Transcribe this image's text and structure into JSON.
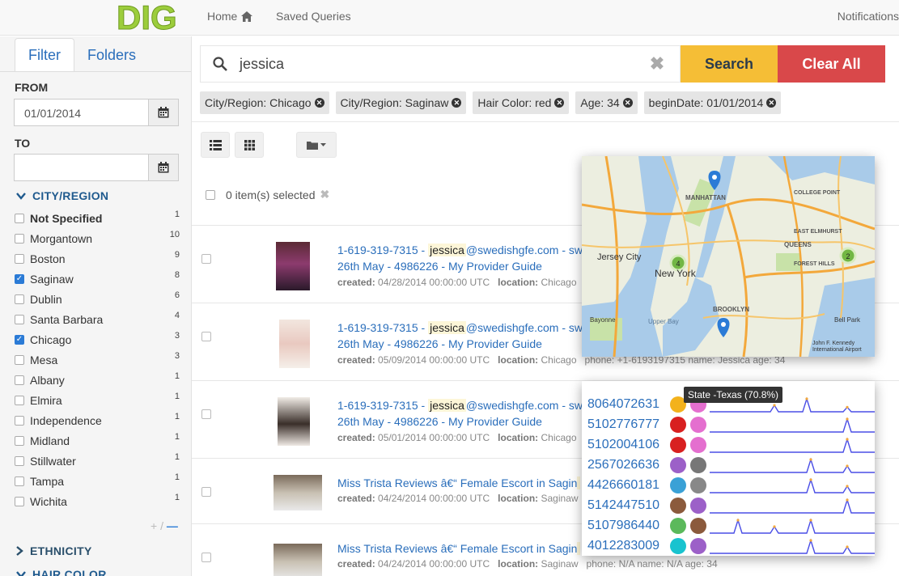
{
  "nav": {
    "logo_text": "DIG",
    "home": "Home",
    "saved_queries": "Saved Queries",
    "notifications": "Notifications"
  },
  "sidebar": {
    "tabs": [
      "Filter",
      "Folders"
    ],
    "from_label": "FROM",
    "from_value": "01/01/2014",
    "to_label": "TO",
    "to_value": "",
    "city_header": "CITY/REGION",
    "cities": [
      {
        "name": "Not Specified",
        "count": "1",
        "checked": false,
        "bold": true
      },
      {
        "name": "Morgantown",
        "count": "10",
        "checked": false
      },
      {
        "name": "Boston",
        "count": "9",
        "checked": false
      },
      {
        "name": "Saginaw",
        "count": "8",
        "checked": true
      },
      {
        "name": "Dublin",
        "count": "6",
        "checked": false
      },
      {
        "name": "Santa Barbara",
        "count": "4",
        "checked": false
      },
      {
        "name": "Chicago",
        "count": "3",
        "checked": true
      },
      {
        "name": "Mesa",
        "count": "3",
        "checked": false
      },
      {
        "name": "Albany",
        "count": "1",
        "checked": false
      },
      {
        "name": "Elmira",
        "count": "1",
        "checked": false
      },
      {
        "name": "Independence",
        "count": "1",
        "checked": false
      },
      {
        "name": "Midland",
        "count": "1",
        "checked": false
      },
      {
        "name": "Stillwater",
        "count": "1",
        "checked": false
      },
      {
        "name": "Tampa",
        "count": "1",
        "checked": false
      },
      {
        "name": "Wichita",
        "count": "1",
        "checked": false
      }
    ],
    "more_less": "+ / −",
    "ethnicity_header": "ETHNICITY",
    "hair_header": "HAIR COLOR"
  },
  "search": {
    "query": "jessica",
    "search_label": "Search",
    "clear_label": "Clear All"
  },
  "chips": [
    "City/Region: Chicago",
    "City/Region: Saginaw",
    "Hair Color: red",
    "Age: 34",
    "beginDate: 01/01/2014"
  ],
  "selection": {
    "text": "0 item(s) selected"
  },
  "results": [
    {
      "phone": "1-619-319-7315 - ",
      "hl": "jessica",
      "rest": "@swedishgfe.com - sw",
      "line2": "26th May - 4986226 - My Provider Guide",
      "created": "04/28/2014 00:00:00 UTC",
      "location": "Chicago",
      "extra": ""
    },
    {
      "phone": "1-619-319-7315 - ",
      "hl": "jessica",
      "rest": "@swedishgfe.com - sw",
      "line2": "26th May - 4986226 - My Provider Guide",
      "created": "05/09/2014 00:00:00 UTC",
      "location": "Chicago",
      "extra": "phone: +1-6193197315   name: Jessica   age: 34"
    },
    {
      "phone": "1-619-319-7315 - ",
      "hl": "jessica",
      "rest": "@swedishgfe.com - sw",
      "line2": "26th May - 4986226 - My Provider Guide",
      "created": "05/01/2014 00:00:00 UTC",
      "location": "Chicago",
      "extra": ""
    },
    {
      "phone": "Miss Trista Reviews â€“ Female Escort in Sagin",
      "hl": "",
      "rest": "",
      "line2": "",
      "created": "04/24/2014 00:00:00 UTC",
      "location": "Saginaw",
      "extra": ""
    },
    {
      "phone": "Miss Trista Reviews â€“ Female Escort in Sagin",
      "hl": "",
      "rest": "",
      "line2": "",
      "created": "04/24/2014 00:00:00 UTC",
      "location": "Saginaw",
      "extra": "phone: N/A   name: N/A   age: 34"
    }
  ],
  "meta_labels": {
    "created": "created:",
    "location": "location:"
  },
  "map": {
    "labels": [
      "Jersey City",
      "New York",
      "BROOKLYN",
      "MANHATTAN",
      "QUEENS",
      "Bayonne",
      "Upper Bay",
      "Bell Park",
      "COLLEGE POINT",
      "EAST ELMHURST",
      "FOREST HILLS",
      "John F. Kennedy International Airport"
    ],
    "clusters": [
      "4",
      "2"
    ]
  },
  "sparklines": {
    "tooltip": "State -Texas (70.8%)",
    "rows": [
      {
        "number": "8064072631",
        "pie1": "#f3b21c",
        "pie2": "#e46fcf"
      },
      {
        "number": "5102776777",
        "pie1": "#d82020",
        "pie2": "#e46fcf"
      },
      {
        "number": "5102004106",
        "pie1": "#d82020",
        "pie2": "#e46fcf"
      },
      {
        "number": "2567026636",
        "pie1": "#9c60c8",
        "pie2": "#777777"
      },
      {
        "number": "4426660181",
        "pie1": "#3aa1d6",
        "pie2": "#888888"
      },
      {
        "number": "5142447510",
        "pie1": "#8b5a3c",
        "pie2": "#9c60c8"
      },
      {
        "number": "5107986440",
        "pie1": "#5bb95b",
        "pie2": "#8b5a3c"
      },
      {
        "number": "4012283009",
        "pie1": "#18c3cf",
        "pie2": "#9c60c8"
      }
    ]
  }
}
